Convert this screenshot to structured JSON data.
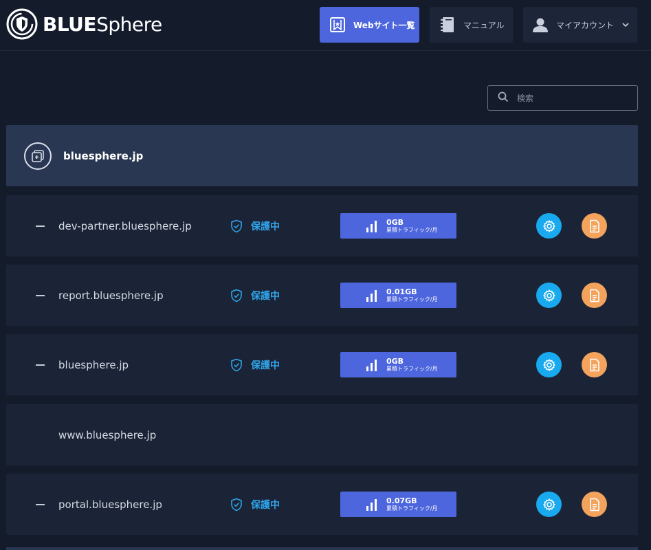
{
  "header": {
    "logo_bold": "BLUE",
    "logo_light": "Sphere",
    "nav": {
      "websites_label": "Webサイト一覧",
      "manual_label": "マニュアル",
      "account_label": "マイアカウント"
    }
  },
  "search": {
    "placeholder": "検索",
    "value": ""
  },
  "group": {
    "name": "bluesphere.jp"
  },
  "rows": [
    {
      "name": "dev-partner.bluesphere.jp",
      "status": "保護中",
      "traffic_value": "0GB",
      "traffic_label": "累積トラフィック/月"
    },
    {
      "name": "report.bluesphere.jp",
      "status": "保護中",
      "traffic_value": "0.01GB",
      "traffic_label": "累積トラフィック/月"
    },
    {
      "name": "bluesphere.jp",
      "status": "保護中",
      "traffic_value": "0GB",
      "traffic_label": "累積トラフィック/月"
    },
    {
      "name": "www.bluesphere.jp"
    },
    {
      "name": "portal.bluesphere.jp",
      "status": "保護中",
      "traffic_value": "0.07GB",
      "traffic_label": "累積トラフィック/月"
    }
  ],
  "colors": {
    "background": "#141c2c",
    "row_bg": "#1b2436",
    "group_bg": "#2a3752",
    "accent_blue": "#4d66dd",
    "status_blue": "#2fa4ea",
    "gear_button": "#19a9ee",
    "doc_button": "#f3a35c"
  },
  "icons": {
    "logo": "shield-sphere-logo-icon",
    "websites": "bookmark-star-icon",
    "manual": "notebook-icon",
    "account": "user-icon",
    "search": "search-icon",
    "group": "copy-add-icon",
    "status": "shield-check-icon",
    "traffic": "signal-bars-icon",
    "settings": "gear-icon",
    "report": "document-icon"
  }
}
